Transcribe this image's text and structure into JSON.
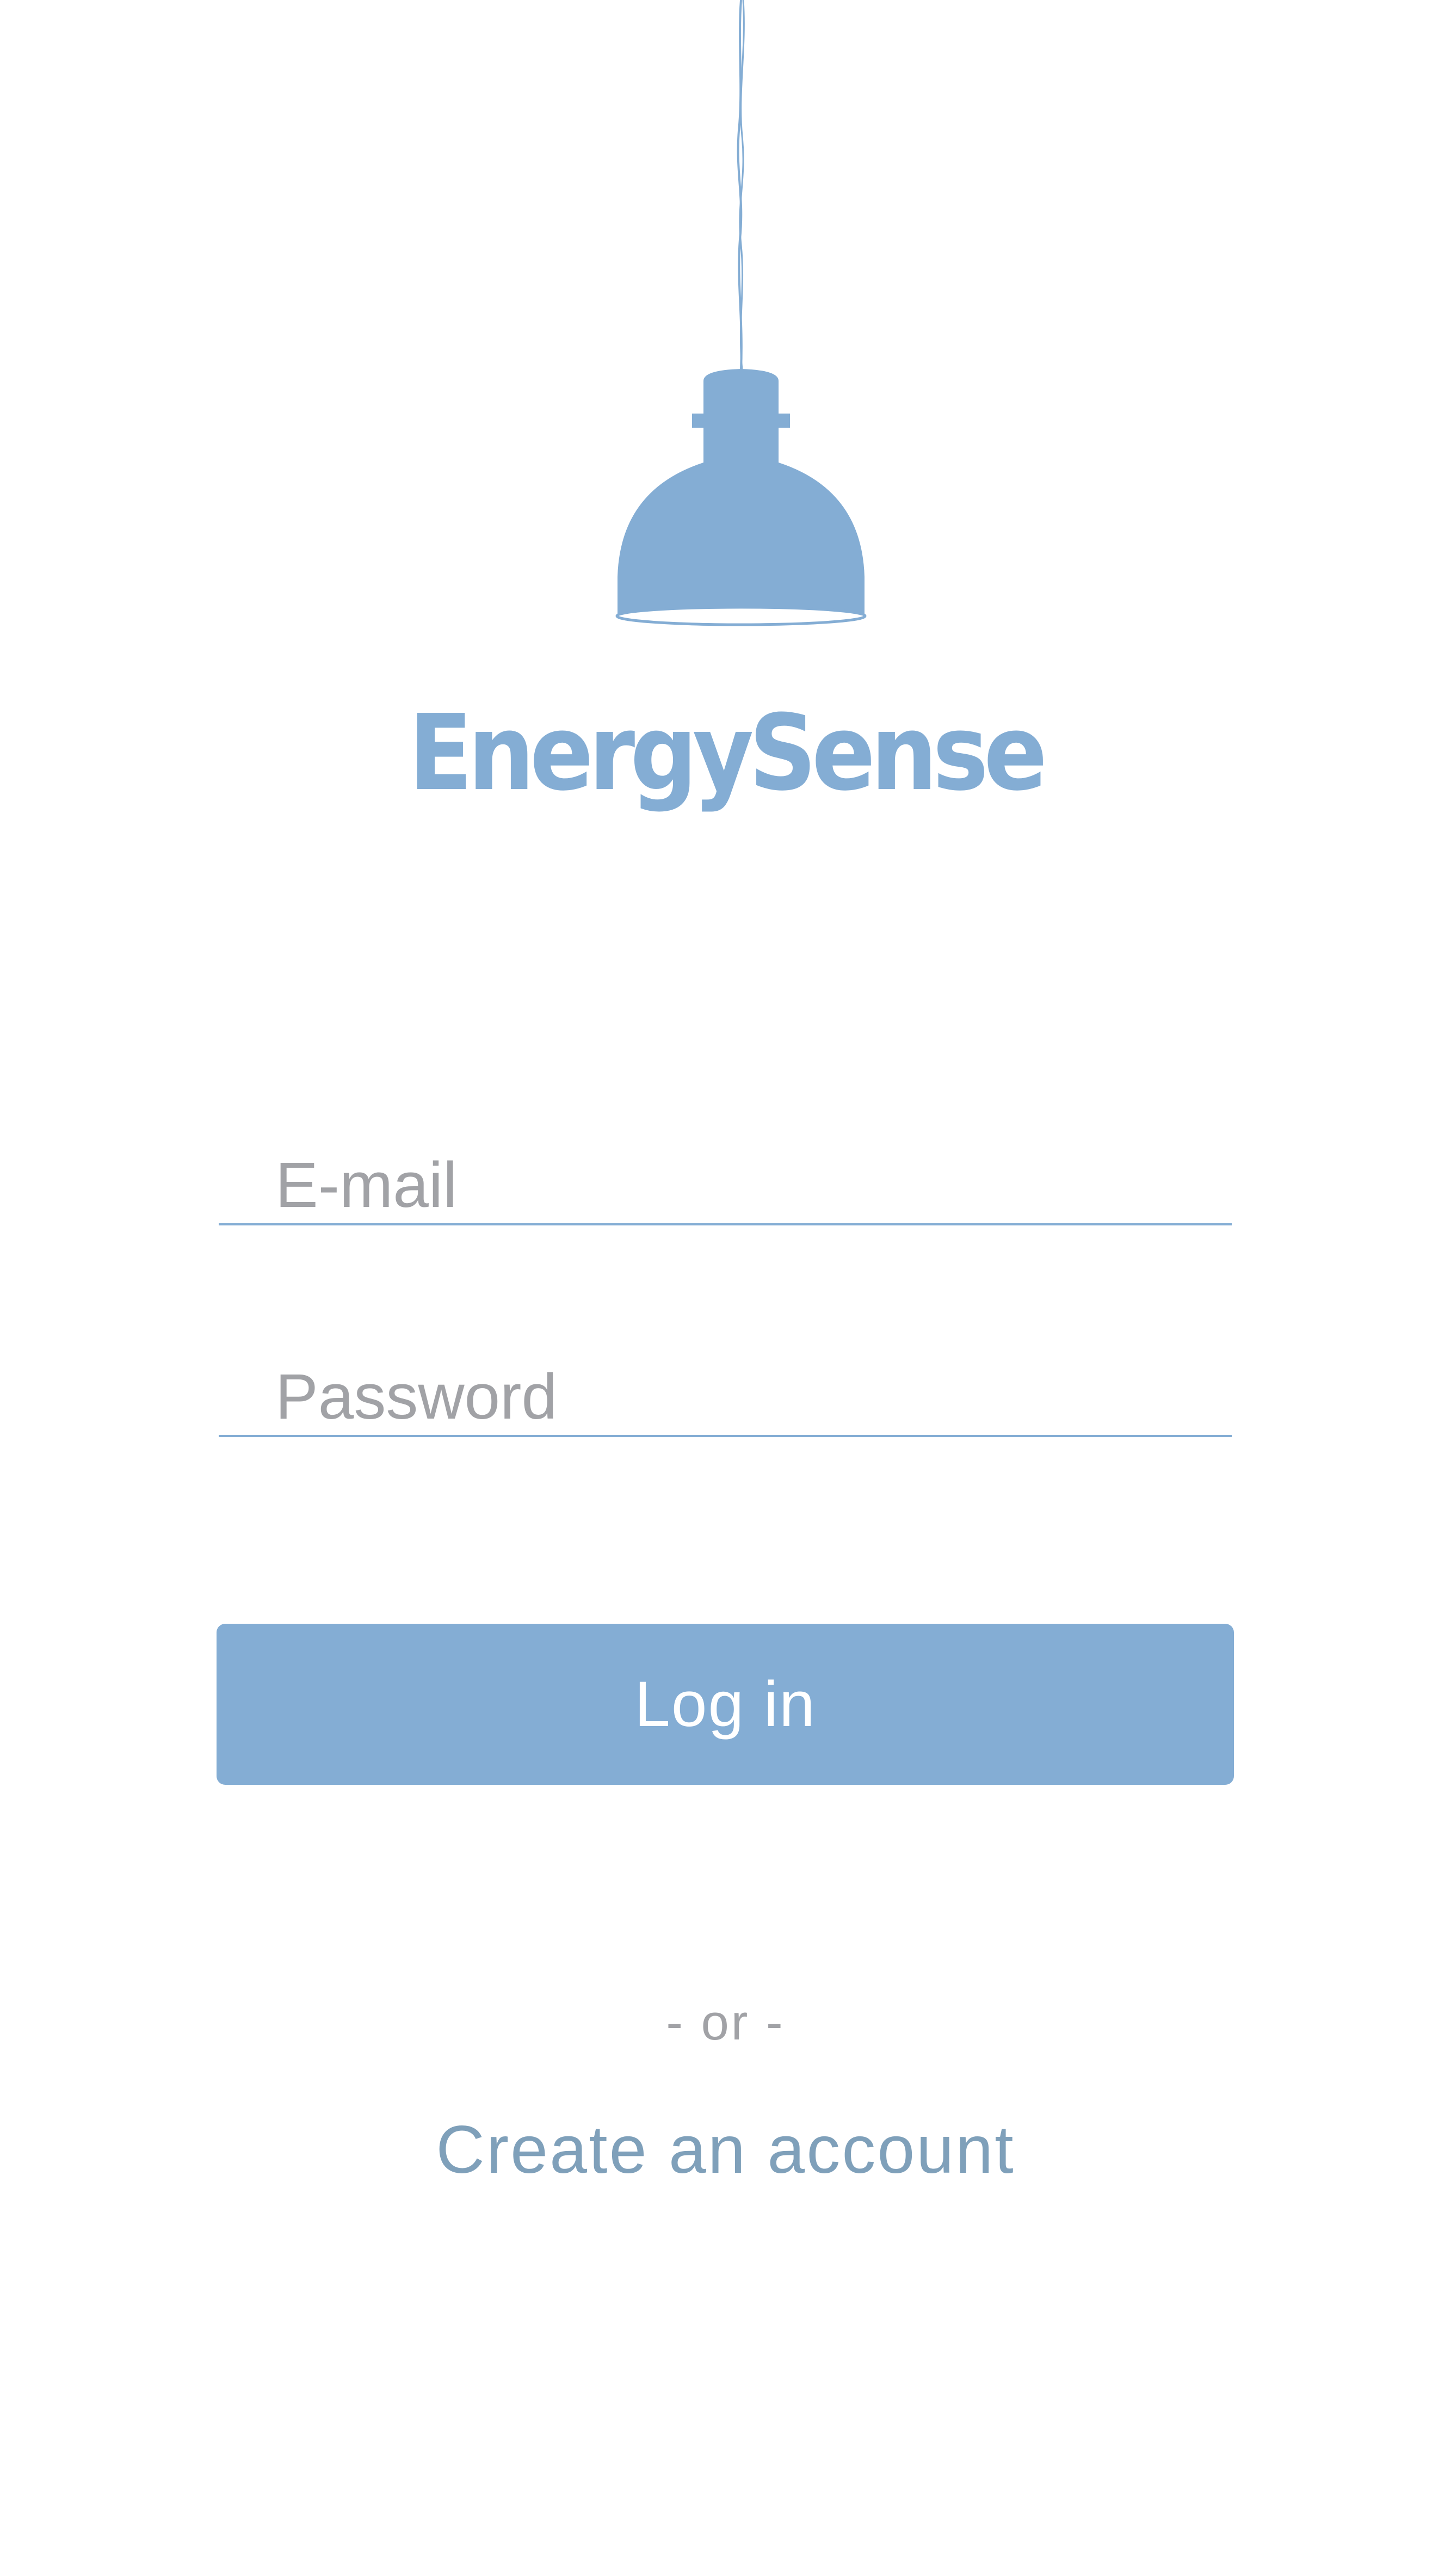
{
  "app": {
    "name": "EnergySense",
    "logo_icon": "pendant-lamp-icon",
    "accent_color": "#84add4",
    "link_color": "#7fa0ba",
    "placeholder_color": "#a1a2a6"
  },
  "login_form": {
    "email": {
      "placeholder": "E-mail",
      "value": ""
    },
    "password": {
      "placeholder": "Password",
      "value": ""
    },
    "submit_label": "Log in"
  },
  "separator": "- or -",
  "create_account_label": "Create an account"
}
